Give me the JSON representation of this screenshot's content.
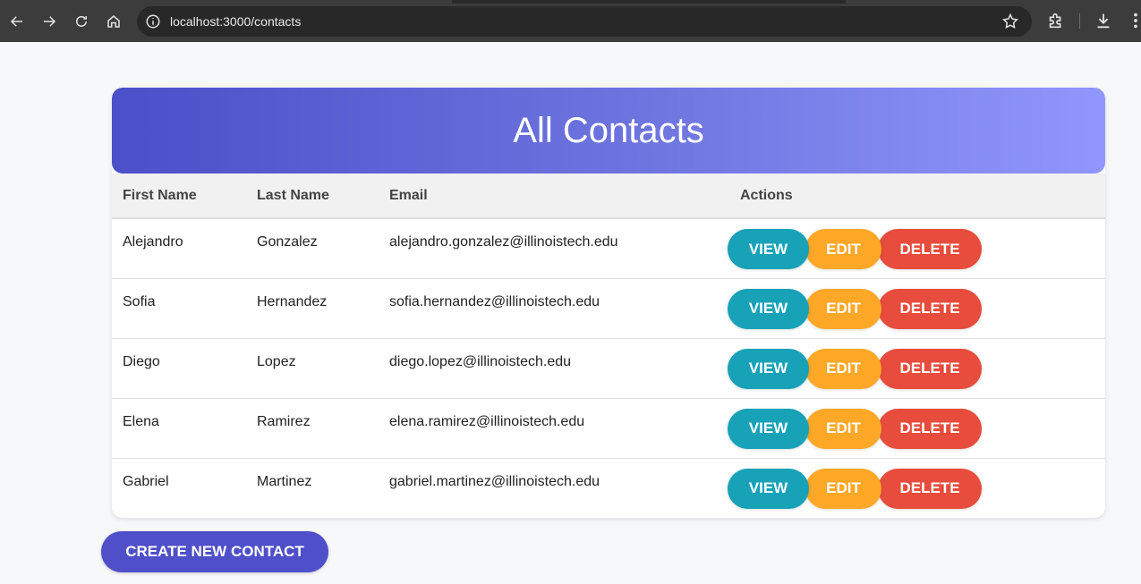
{
  "browser": {
    "url": "localhost:3000/contacts"
  },
  "page": {
    "title": "All Contacts",
    "create_button_label": "CREATE NEW CONTACT"
  },
  "table": {
    "headers": {
      "first_name": "First Name",
      "last_name": "Last Name",
      "email": "Email",
      "actions": "Actions"
    },
    "action_labels": {
      "view": "VIEW",
      "edit": "EDIT",
      "delete": "DELETE"
    },
    "rows": [
      {
        "first_name": "Alejandro",
        "last_name": "Gonzalez",
        "email": "alejandro.gonzalez@illinoistech.edu"
      },
      {
        "first_name": "Sofia",
        "last_name": "Hernandez",
        "email": "sofia.hernandez@illinoistech.edu"
      },
      {
        "first_name": "Diego",
        "last_name": "Lopez",
        "email": "diego.lopez@illinoistech.edu"
      },
      {
        "first_name": "Elena",
        "last_name": "Ramirez",
        "email": "elena.ramirez@illinoistech.edu"
      },
      {
        "first_name": "Gabriel",
        "last_name": "Martinez",
        "email": "gabriel.martinez@illinoistech.edu"
      }
    ]
  },
  "colors": {
    "header_gradient_start": "#4b4fc9",
    "header_gradient_end": "#9096fb",
    "view": "#17a2b8",
    "edit": "#ffa726",
    "delete": "#e74c3c",
    "create": "#4f4fc9"
  },
  "icons": [
    "back-icon",
    "forward-icon",
    "reload-icon",
    "home-icon",
    "site-info-icon",
    "bookmark-star-icon",
    "extensions-icon",
    "download-icon",
    "menu-icon"
  ]
}
